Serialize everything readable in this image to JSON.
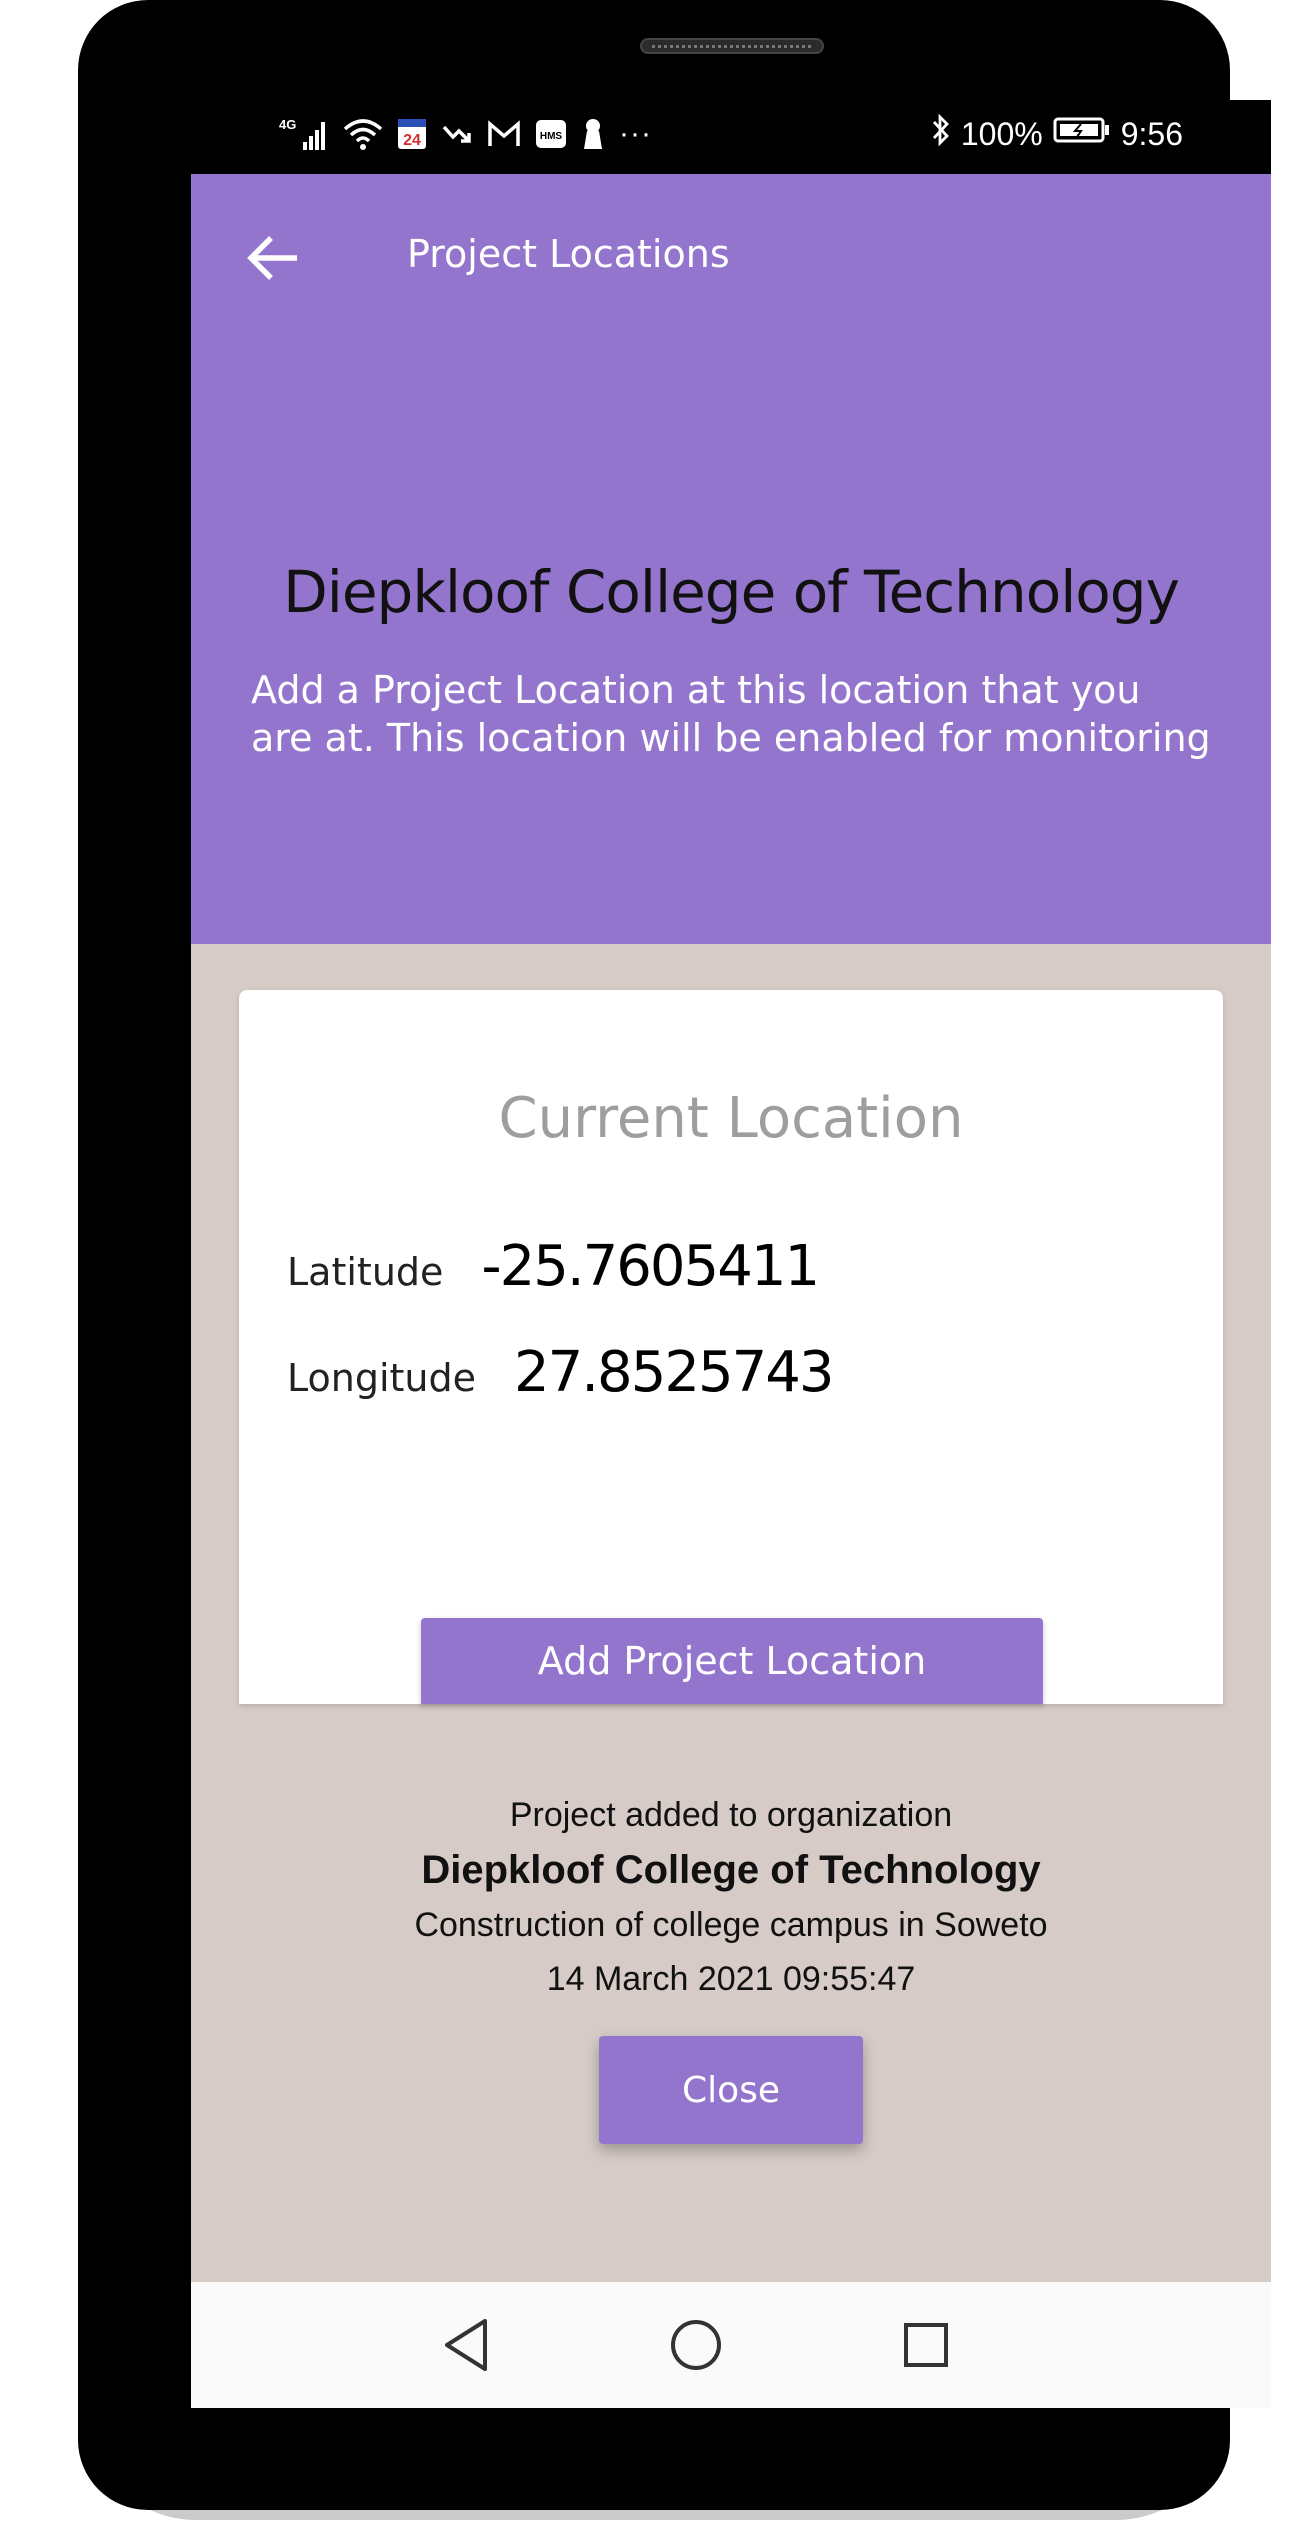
{
  "status_bar": {
    "left_icons": [
      "4g-signal-icon",
      "wifi-icon",
      "news24-icon",
      "missed-call-icon",
      "gmail-icon",
      "hms-icon",
      "keyhole-icon",
      "more-dots-icon"
    ],
    "network_label": "4G",
    "news_label": "24",
    "hms_label": "HMS",
    "more_label": "···",
    "battery": "100%",
    "time": "9:56"
  },
  "app_bar": {
    "title": "Project Locations",
    "back_icon": "arrow-back-icon"
  },
  "header": {
    "org_name": "Diepkloof College of Technology",
    "description": "Add a Project Location at this location that you are at. This location will be enabled for monitoring"
  },
  "card": {
    "title": "Current Location",
    "latitude_label": "Latitude",
    "latitude_value": "-25.7605411",
    "longitude_label": "Longitude",
    "longitude_value": "27.8525743",
    "add_button_label": "Add Project Location"
  },
  "message": {
    "line1": "Project added to organization",
    "org_name": "Diepkloof College of Technology",
    "project_description": "Construction of college campus in Soweto",
    "timestamp": "14 March 2021 09:55:47",
    "close_label": "Close"
  },
  "colors": {
    "primary": "#9475cd",
    "background": "#d6cbc7"
  },
  "nav_bar": [
    "back-triangle-icon",
    "home-circle-icon",
    "recents-square-icon"
  ]
}
